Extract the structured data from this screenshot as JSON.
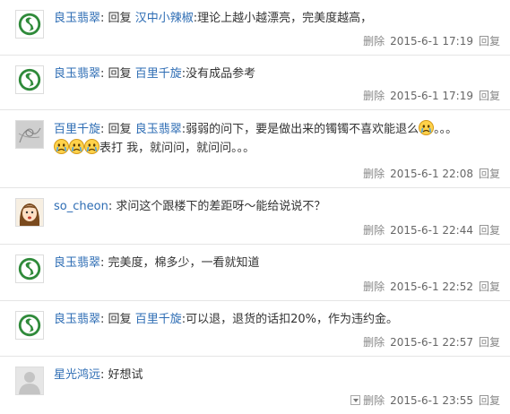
{
  "reply_word": "回复",
  "comments": [
    {
      "avatar": "jade-logo-avatar",
      "user": "良玉翡翠",
      "target": "汉中小辣椒",
      "text": ":理论上越小越漂亮，完美度越高，",
      "delete_label": "删除",
      "time": "2015-6-1 17:19",
      "reply_label": "回复"
    },
    {
      "avatar": "jade-logo-avatar",
      "user": "良玉翡翠",
      "target": "百里千旋",
      "text": ":没有成品参考",
      "delete_label": "删除",
      "time": "2015-6-1 17:19",
      "reply_label": "回复"
    },
    {
      "avatar": "sketch-avatar",
      "user": "百里千旋",
      "target": "良玉翡翠",
      "text": ":弱弱的问下，要是做出来的镯镯不喜欢能退么",
      "text2": "。。。",
      "text3": "表打 我，就问问，就问问。。。",
      "delete_label": "删除",
      "time": "2015-6-1 22:08",
      "reply_label": "回复"
    },
    {
      "avatar": "girl-avatar",
      "user": "so_cheon",
      "text": "求问这个跟楼下的差距呀～能给说说不？",
      "delete_label": "删除",
      "time": "2015-6-1 22:44",
      "reply_label": "回复"
    },
    {
      "avatar": "jade-logo-avatar",
      "user": "良玉翡翠",
      "text": "完美度，棉多少，一看就知道",
      "delete_label": "删除",
      "time": "2015-6-1 22:52",
      "reply_label": "回复"
    },
    {
      "avatar": "jade-logo-avatar",
      "user": "良玉翡翠",
      "target": "百里千旋",
      "text": ":可以退，退货的话扣20%，作为违约金。",
      "delete_label": "删除",
      "time": "2015-6-1 22:57",
      "reply_label": "回复"
    },
    {
      "avatar": "default-avatar",
      "user": "星光鸿远",
      "text": "好想试",
      "delete_label": "删除",
      "time": "2015-6-1 23:55",
      "reply_label": "回复"
    }
  ]
}
